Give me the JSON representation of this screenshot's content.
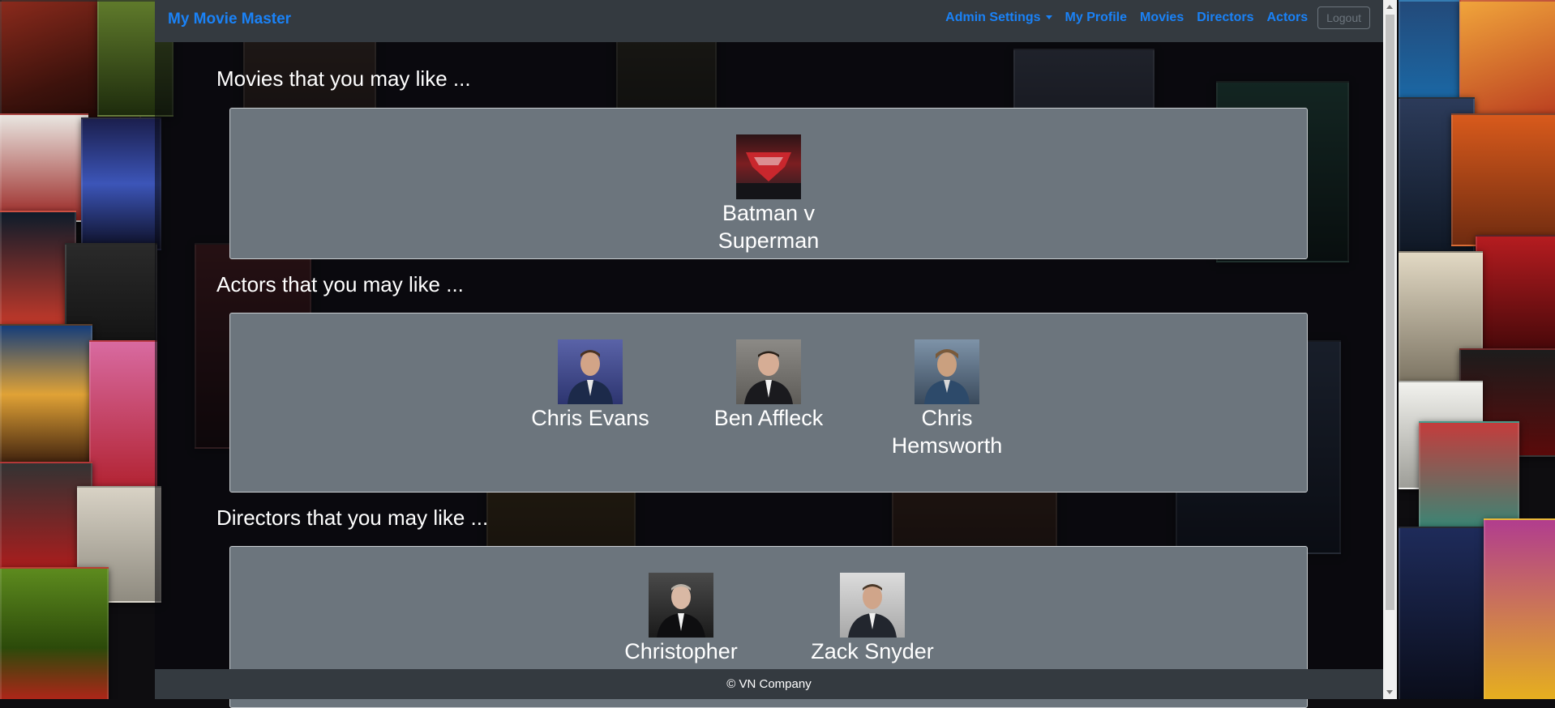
{
  "navbar": {
    "brand": "My Movie Master",
    "admin_settings": "Admin Settings",
    "my_profile": "My Profile",
    "movies": "Movies",
    "directors": "Directors",
    "actors": "Actors",
    "logout": "Logout"
  },
  "sections": {
    "movies": {
      "title": "Movies that you may like ...",
      "items": [
        {
          "name": "Batman v Superman"
        }
      ]
    },
    "actors": {
      "title": "Actors that you may like ...",
      "items": [
        {
          "name": "Chris Evans"
        },
        {
          "name": "Ben Affleck"
        },
        {
          "name": "Chris Hemsworth"
        }
      ]
    },
    "directors": {
      "title": "Directors that you may like ...",
      "items": [
        {
          "name": "Christopher Nolan"
        },
        {
          "name": "Zack Snyder"
        }
      ]
    }
  },
  "footer": {
    "text": "© VN Company"
  },
  "colors": {
    "navbar_bg": "#343a40",
    "brand": "#1a82f7",
    "card_bg": "#6c757d",
    "footer_bg": "#343a40"
  }
}
